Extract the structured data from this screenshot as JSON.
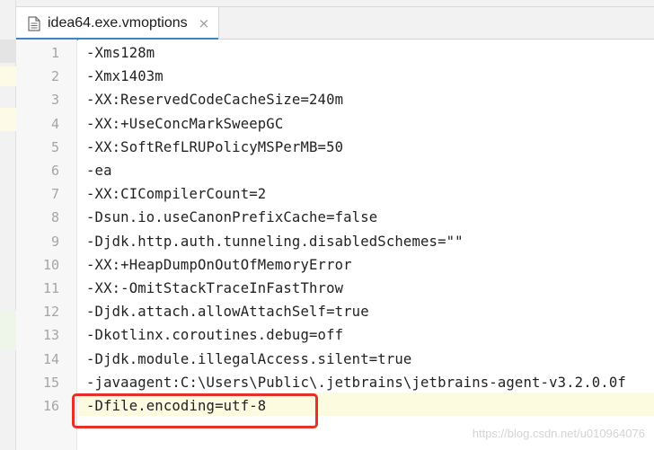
{
  "tab": {
    "label": "idea64.exe.vmoptions",
    "close_glyph": "×",
    "file_icon": "text-file-icon"
  },
  "editor": {
    "lines": [
      {
        "number": "1",
        "text": "-Xms128m"
      },
      {
        "number": "2",
        "text": "-Xmx1403m"
      },
      {
        "number": "3",
        "text": "-XX:ReservedCodeCacheSize=240m"
      },
      {
        "number": "4",
        "text": "-XX:+UseConcMarkSweepGC"
      },
      {
        "number": "5",
        "text": "-XX:SoftRefLRUPolicyMSPerMB=50"
      },
      {
        "number": "6",
        "text": "-ea"
      },
      {
        "number": "7",
        "text": "-XX:CICompilerCount=2"
      },
      {
        "number": "8",
        "text": "-Dsun.io.useCanonPrefixCache=false"
      },
      {
        "number": "9",
        "text": "-Djdk.http.auth.tunneling.disabledSchemes=\"\""
      },
      {
        "number": "10",
        "text": "-XX:+HeapDumpOnOutOfMemoryError"
      },
      {
        "number": "11",
        "text": "-XX:-OmitStackTraceInFastThrow"
      },
      {
        "number": "12",
        "text": "-Djdk.attach.allowAttachSelf=true"
      },
      {
        "number": "13",
        "text": "-Dkotlinx.coroutines.debug=off"
      },
      {
        "number": "14",
        "text": "-Djdk.module.illegalAccess.silent=true"
      },
      {
        "number": "15",
        "text": "-javaagent:C:\\Users\\Public\\.jetbrains\\jetbrains-agent-v3.2.0.0f"
      },
      {
        "number": "16",
        "text": "-Dfile.encoding=utf-8"
      }
    ]
  },
  "watermark": "https://blog.csdn.net/u010964076",
  "colors": {
    "highlight_box": "#e63028",
    "tab_underline": "#4083c9",
    "current_line": "#fcfadf"
  }
}
